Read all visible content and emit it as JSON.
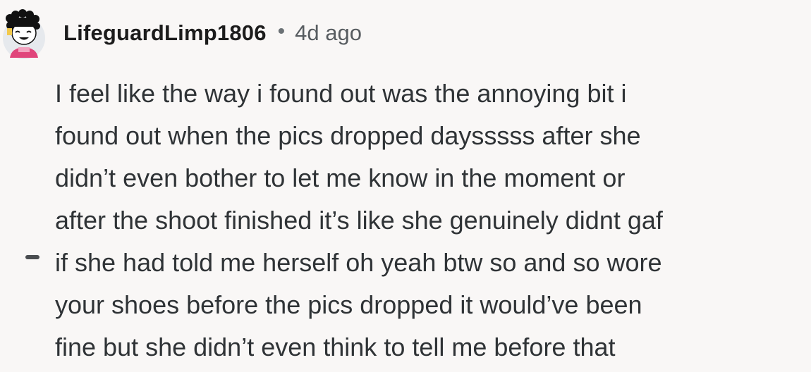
{
  "comment": {
    "author": "LifeguardLimp1806",
    "separator": "•",
    "timestamp": "4d ago",
    "avatar_icon": "avatar-icon",
    "collapse_icon": "collapse-thread-icon",
    "body_lines": [
      "I feel like the way i found out was the annoying bit i",
      "found out when the pics dropped daysssss after she",
      "didn’t even bother to let me know in the moment or",
      "after the shoot finished it’s like she genuinely didnt gaf",
      "if she had told me herself oh yeah btw so and so wore",
      "your shoes before the pics dropped it would’ve been",
      "fine but she didn’t even think to tell me before that"
    ]
  },
  "colors": {
    "background": "#f9f7f6",
    "text": "#2f3336",
    "username": "#1c1c1c",
    "muted": "#575c60",
    "avatar_bg": "#e6e9ed",
    "avatar_shirt": "#e0457b"
  }
}
